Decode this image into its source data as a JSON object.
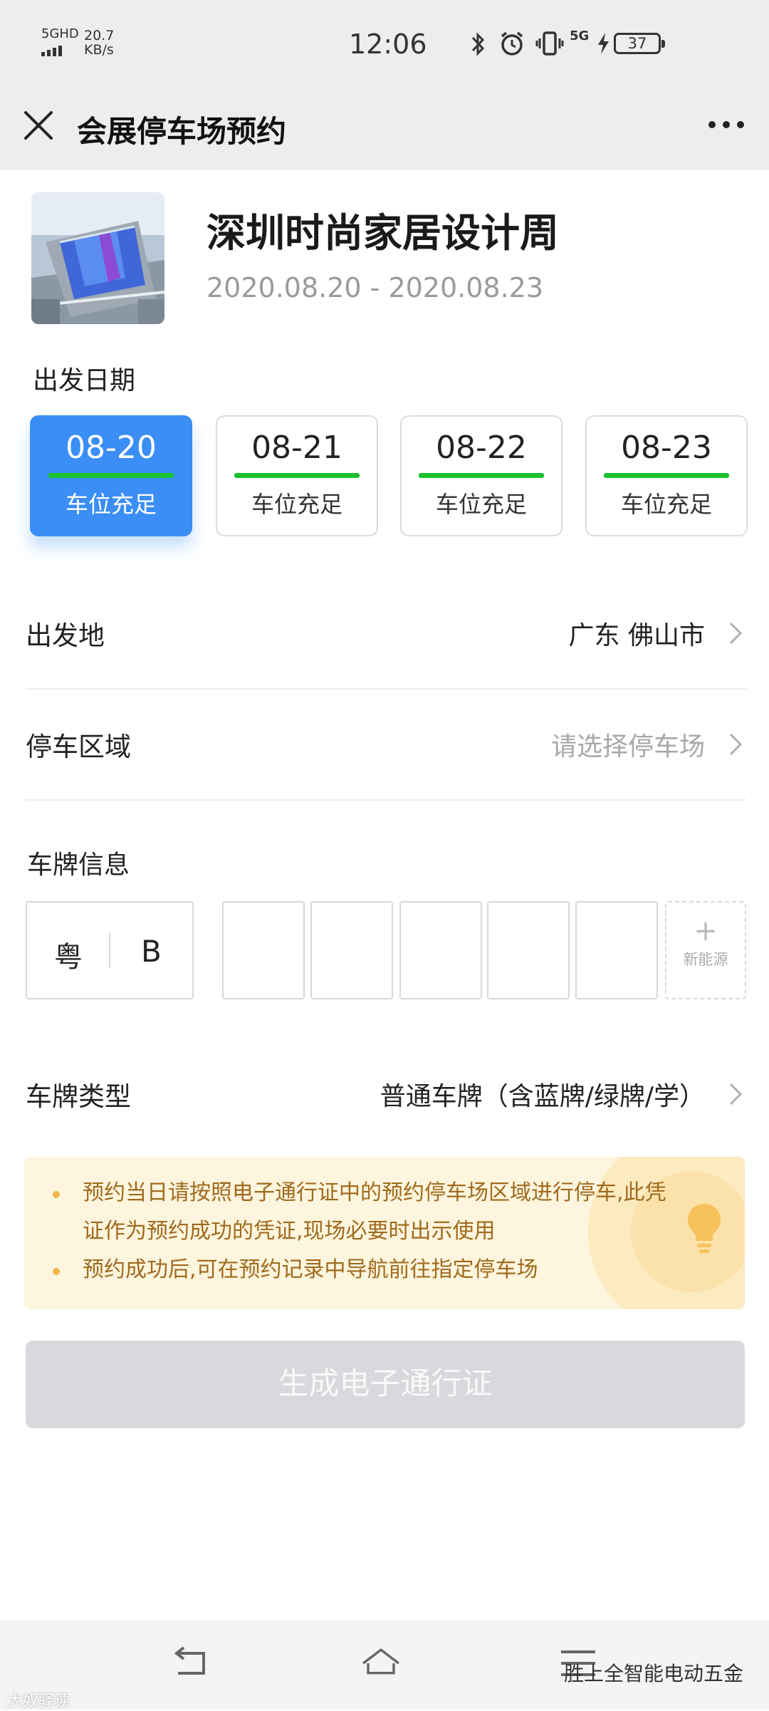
{
  "status_bar": {
    "network": "5GHD",
    "speed_value": "20.7",
    "speed_unit": "KB/s",
    "time": "12:06",
    "signal_5g": "5G",
    "battery": "37",
    "icons": [
      "bluetooth-icon",
      "alarm-icon",
      "vibrate-icon",
      "charging-icon"
    ]
  },
  "nav": {
    "title": "会展停车场预约",
    "close_icon": "close-icon",
    "more_icon": "more-icon"
  },
  "event": {
    "title": "深圳时尚家居设计周",
    "dates": "2020.08.20 - 2020.08.23"
  },
  "date_section": {
    "label": "出发日期",
    "dates": [
      {
        "date": "08-20",
        "status": "车位充足",
        "selected": true
      },
      {
        "date": "08-21",
        "status": "车位充足",
        "selected": false
      },
      {
        "date": "08-22",
        "status": "车位充足",
        "selected": false
      },
      {
        "date": "08-23",
        "status": "车位充足",
        "selected": false
      }
    ]
  },
  "origin": {
    "label": "出发地",
    "value": "广东 佛山市"
  },
  "parking_area": {
    "label": "停车区域",
    "placeholder": "请选择停车场"
  },
  "plate": {
    "label": "车牌信息",
    "province": "粤",
    "letter": "B",
    "new_energy_plus": "+",
    "new_energy_label": "新能源"
  },
  "plate_type": {
    "label": "车牌类型",
    "value": "普通车牌（含蓝牌/绿牌/学）"
  },
  "notice": {
    "items": [
      "预约当日请按照电子通行证中的预约停车场区域进行停车,此凭证作为预约成功的凭证,现场必要时出示使用",
      "预约成功后,可在预约记录中导航前往指定停车场"
    ],
    "icon": "lightbulb-icon"
  },
  "submit_label": "生成电子通行证",
  "bottom_nav": {
    "icons": [
      "back-icon",
      "home-icon",
      "menu-icon"
    ]
  },
  "watermarks": {
    "left": "大奴驿读",
    "right": "胜上全智能电动五金"
  },
  "colors": {
    "accent": "#3a8ef5",
    "available_green": "#19c12c",
    "notice_bg": "#fdf5dd",
    "notice_text": "#a06a1e",
    "button_disabled": "#d7d9dc"
  }
}
